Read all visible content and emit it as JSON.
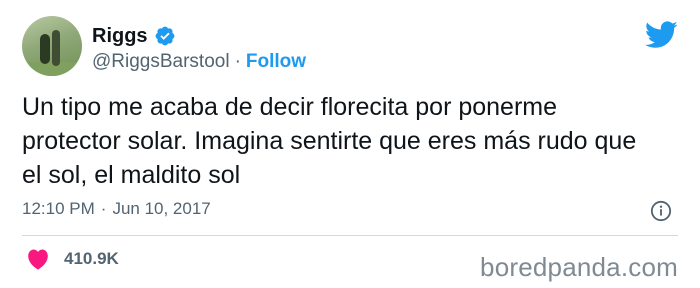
{
  "tweet": {
    "author_name": "Riggs",
    "handle": "@RiggsBarstool",
    "separator": "·",
    "follow_label": "Follow",
    "text": "Un tipo me acaba de decir florecita por ponerme protector solar. Imagina sentirte que eres más rudo que el sol, el maldito sol",
    "time": "12:10 PM",
    "date": "Jun 10, 2017",
    "likes": "410.9K"
  },
  "icons": {
    "verified": "verified-badge-icon",
    "brand": "twitter-bird-icon",
    "info": "info-icon",
    "like": "heart-icon"
  },
  "colors": {
    "accent": "#1d9bf0",
    "like": "#f91880",
    "muted": "#536471"
  },
  "watermark": "boredpanda.com"
}
